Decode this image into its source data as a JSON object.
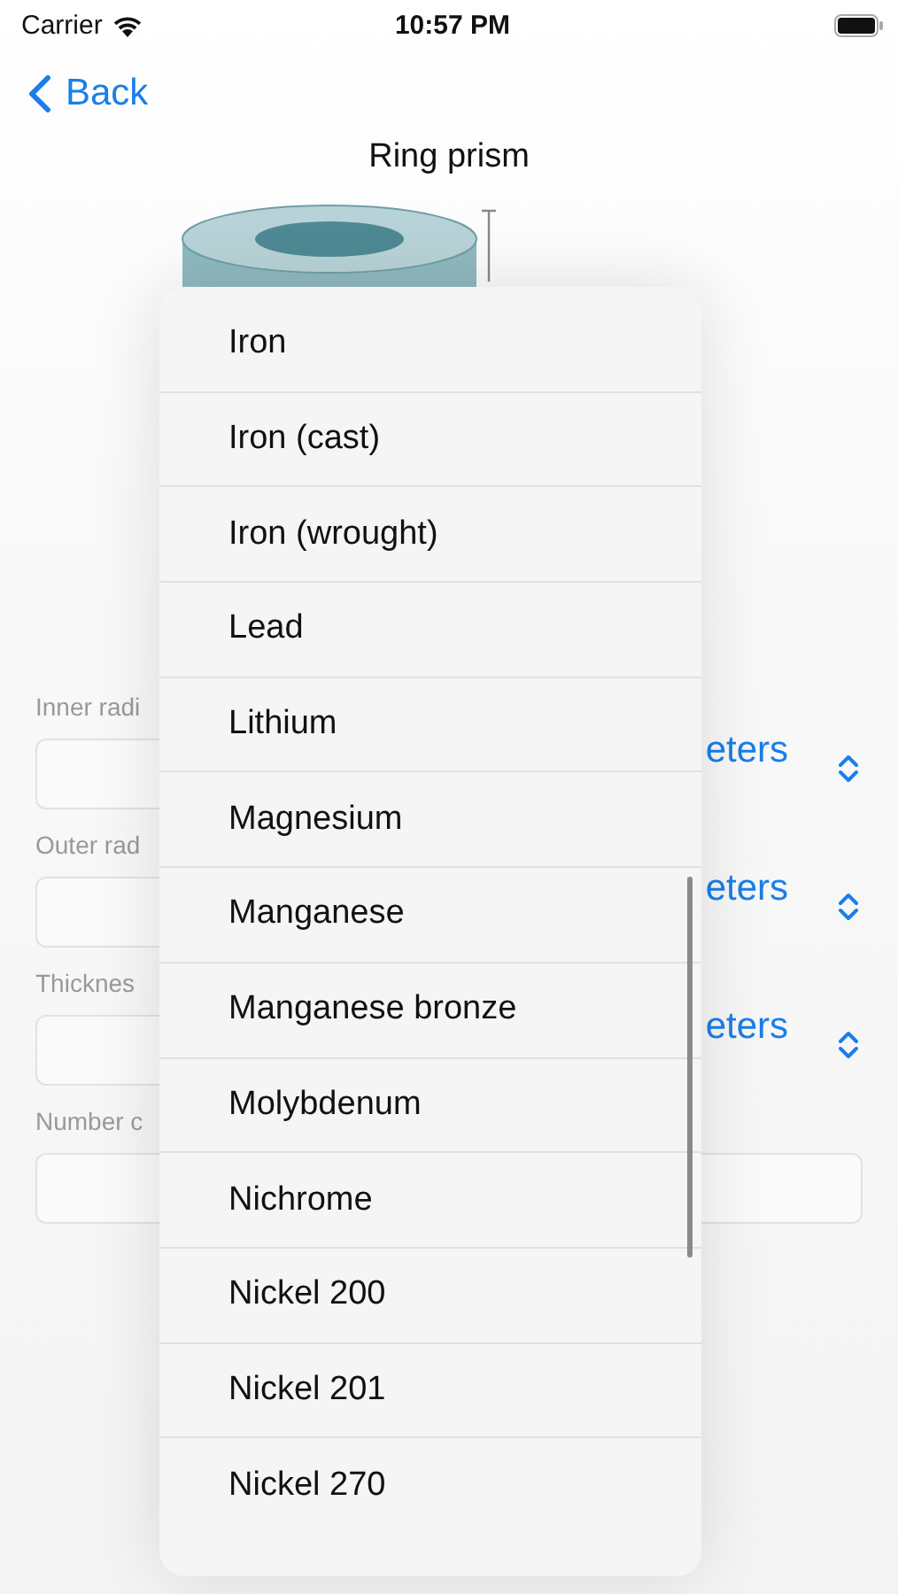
{
  "status_bar": {
    "carrier": "Carrier",
    "time": "10:57 PM"
  },
  "nav": {
    "back": "Back"
  },
  "title": "Ring prism",
  "fields": [
    {
      "label": "Inner radi",
      "kind": "unit",
      "unit": "eters"
    },
    {
      "label": "Outer rad",
      "kind": "unit",
      "unit": "eters"
    },
    {
      "label": "Thicknes",
      "kind": "unit",
      "unit": "eters"
    },
    {
      "label": "Number c",
      "kind": "plain"
    }
  ],
  "menu": {
    "items": [
      "Iron",
      "Iron (cast)",
      "Iron (wrought)",
      "Lead",
      "Lithium",
      "Magnesium",
      "Manganese",
      "Manganese bronze",
      "Molybdenum",
      "Nichrome",
      "Nickel 200",
      "Nickel 201",
      "Nickel 270"
    ]
  }
}
